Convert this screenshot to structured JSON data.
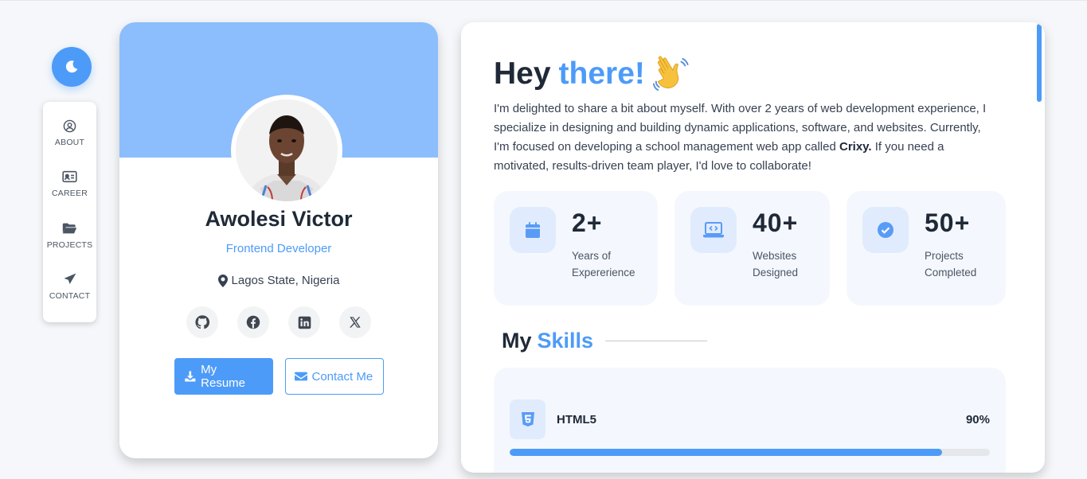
{
  "nav": {
    "items": [
      {
        "label": "ABOUT",
        "icon": "user-circle-icon"
      },
      {
        "label": "CAREER",
        "icon": "id-card-icon"
      },
      {
        "label": "PROJECTS",
        "icon": "folder-open-icon"
      },
      {
        "label": "CONTACT",
        "icon": "paper-plane-icon"
      }
    ],
    "theme_icon": "moon-icon"
  },
  "profile": {
    "name": "Awolesi Victor",
    "role": "Frontend Developer",
    "location": "Lagos State, Nigeria",
    "socials": [
      "github-icon",
      "facebook-icon",
      "linkedin-icon",
      "x-icon"
    ],
    "resume_label": "My Resume",
    "contact_label": "Contact Me"
  },
  "about": {
    "greeting_prefix": "Hey",
    "greeting_accent": "there!",
    "bio_before": "I'm delighted to share a bit about myself. With over 2 years of web development experience, I specialize in designing and building dynamic applications, software, and websites. Currently, I'm focused on developing a school management web app called",
    "bio_bold": "Crixy.",
    "bio_after": " If you need a motivated, results-driven team player, I'd love to collaborate!"
  },
  "stats": [
    {
      "value": "2+",
      "label": "Years of\nExpererience",
      "icon": "calendar-icon"
    },
    {
      "value": "40+",
      "label": "Websites\nDesigned",
      "icon": "laptop-code-icon"
    },
    {
      "value": "50+",
      "label": "Projects\nCompleted",
      "icon": "check-circle-icon"
    }
  ],
  "skills": {
    "heading_prefix": "My",
    "heading_accent": "Skills",
    "items": [
      {
        "name": "HTML5",
        "percent_label": "90%",
        "level": 0.9,
        "icon": "html5-icon"
      }
    ]
  },
  "colors": {
    "accent": "#4d9bf8",
    "banner": "#8cbdfd",
    "card_tint": "#f4f8fe"
  }
}
